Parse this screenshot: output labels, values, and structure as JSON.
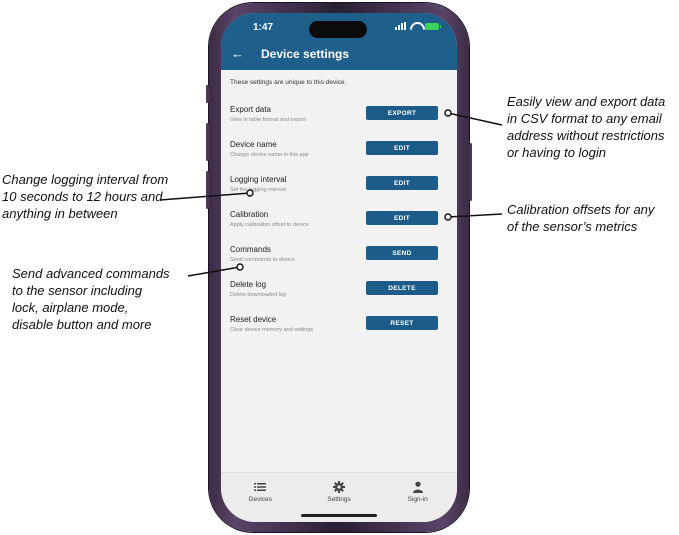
{
  "status": {
    "time": "1:47"
  },
  "app_bar": {
    "title": "Device settings",
    "back_icon": "back-arrow-icon"
  },
  "intro": "These settings are unique to this device.",
  "settings": [
    {
      "title": "Export data",
      "subtitle": "View in table format and export",
      "action": "EXPORT"
    },
    {
      "title": "Device name",
      "subtitle": "Change device name in this app",
      "action": "EDIT"
    },
    {
      "title": "Logging interval",
      "subtitle": "Set the logging interval",
      "action": "EDIT"
    },
    {
      "title": "Calibration",
      "subtitle": "Apply calibration offset to device",
      "action": "EDIT"
    },
    {
      "title": "Commands",
      "subtitle": "Send commands to device",
      "action": "SEND"
    },
    {
      "title": "Delete log",
      "subtitle": "Delete downloaded log",
      "action": "DELETE"
    },
    {
      "title": "Reset device",
      "subtitle": "Clear device memory and settings",
      "action": "RESET"
    }
  ],
  "bottom_nav": [
    {
      "label": "Devices",
      "icon": "list-icon"
    },
    {
      "label": "Settings",
      "icon": "gear-icon"
    },
    {
      "label": "Sign-in",
      "icon": "person-icon"
    }
  ],
  "annotations": {
    "export": [
      "Easily view and export data",
      "in CSV format to any email",
      "address without restrictions",
      "or having to login"
    ],
    "logging": [
      "Change logging interval from",
      "10 seconds to 12 hours and",
      "anything in between"
    ],
    "calibration": [
      "Calibration offsets for any",
      "of the sensor’s metrics"
    ],
    "commands": [
      "Send advanced commands",
      "to the sensor including",
      "lock, airplane mode,",
      "disable button and more"
    ]
  },
  "colors": {
    "app_bar": "#1e5f8c",
    "button": "#1d5c88",
    "frame": "#4a3856"
  }
}
